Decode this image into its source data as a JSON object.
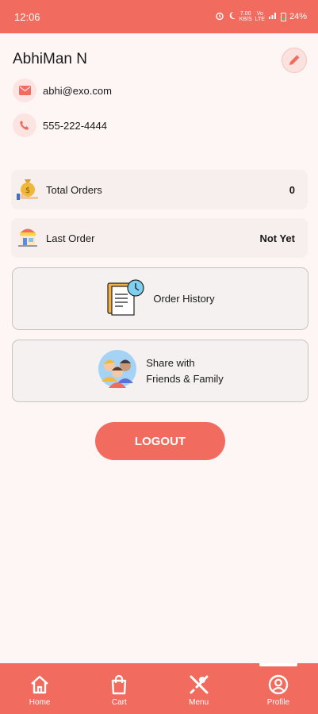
{
  "status_bar": {
    "time": "12:06",
    "speed_top": "7.00",
    "speed_unit": "KB/S",
    "network_top": "Vo",
    "network_bottom": "LTE",
    "signal": "4G",
    "battery": "24%"
  },
  "profile": {
    "name": "AbhiMan N",
    "email": "abhi@exo.com",
    "phone": "555-222-4444"
  },
  "stats": {
    "total_orders_label": "Total Orders",
    "total_orders_value": "0",
    "last_order_label": "Last Order",
    "last_order_value": "Not Yet"
  },
  "actions": {
    "order_history_label": "Order History",
    "share_line1": "Share with",
    "share_line2": "Friends & Family"
  },
  "logout_label": "LOGOUT",
  "nav": {
    "items": [
      {
        "label": "Home",
        "icon": "home-icon"
      },
      {
        "label": "Cart",
        "icon": "cart-icon"
      },
      {
        "label": "Menu",
        "icon": "menu-icon"
      },
      {
        "label": "Profile",
        "icon": "profile-icon"
      }
    ],
    "active": "Profile"
  },
  "colors": {
    "accent": "#f26b5f",
    "background": "#fdf6f5"
  }
}
